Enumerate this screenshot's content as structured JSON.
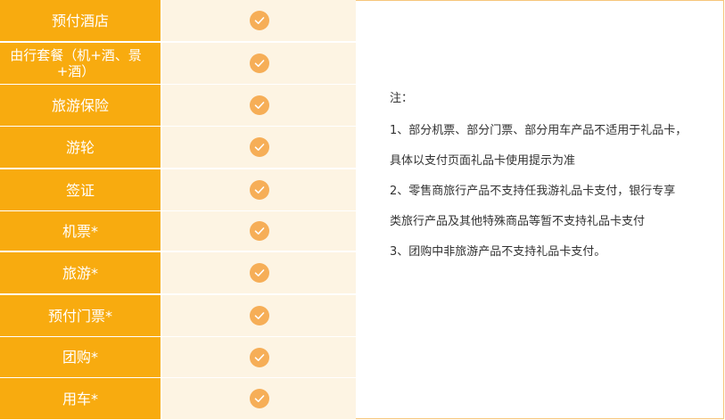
{
  "rows": [
    {
      "label": "预付酒店",
      "checked": true
    },
    {
      "label": "由行套餐（机+酒、景+酒）",
      "checked": true
    },
    {
      "label": "旅游保险",
      "checked": true
    },
    {
      "label": "游轮",
      "checked": true
    },
    {
      "label": "签证",
      "checked": true
    },
    {
      "label": "机票*",
      "checked": true
    },
    {
      "label": "旅游*",
      "checked": true
    },
    {
      "label": "预付门票*",
      "checked": true
    },
    {
      "label": "团购*",
      "checked": true
    },
    {
      "label": "用车*",
      "checked": true
    }
  ],
  "notes": {
    "title": "注：",
    "lines": [
      "1、部分机票、部分门票、部分用车产品不适用于礼品卡，",
      "具体以支付页面礼品卡使用提示为准",
      "2、零售商旅行产品不支持任我游礼品卡支付，银行专享",
      "类旅行产品及其他特殊商品等暂不支持礼品卡支付",
      "3、团购中非旅游产品不支持礼品卡支付。"
    ]
  },
  "colors": {
    "label_bg": "#f8ab0f",
    "check_bg": "#fdf4e3",
    "check_icon": "#f6ae57",
    "border": "#f6c57a"
  }
}
